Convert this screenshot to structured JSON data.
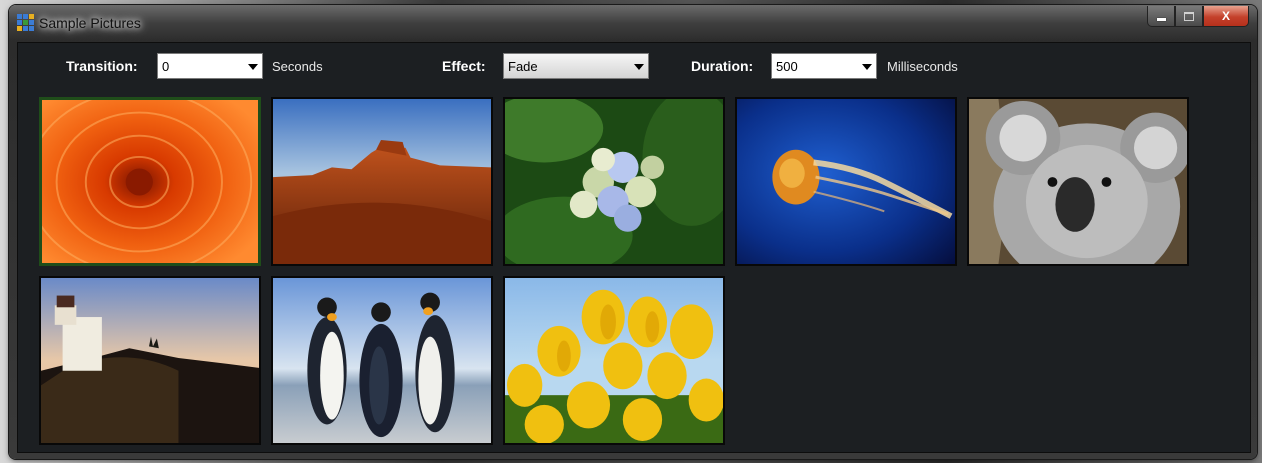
{
  "window": {
    "title": "Sample Pictures",
    "close_glyph": "X"
  },
  "toolbar": {
    "transition": {
      "label": "Transition:",
      "value": "0",
      "unit": "Seconds"
    },
    "effect": {
      "label": "Effect:",
      "value": "Fade"
    },
    "duration": {
      "label": "Duration:",
      "value": "500",
      "unit": "Milliseconds"
    }
  },
  "thumbnails": [
    {
      "subject": "chrysanthemum",
      "selected": true
    },
    {
      "subject": "desert"
    },
    {
      "subject": "hydrangeas"
    },
    {
      "subject": "jellyfish"
    },
    {
      "subject": "koala"
    },
    {
      "subject": "lighthouse"
    },
    {
      "subject": "penguins"
    },
    {
      "subject": "tulips"
    }
  ],
  "colors": {
    "client_bg": "#1c1f22",
    "selected_border": "#1f4d1a"
  }
}
